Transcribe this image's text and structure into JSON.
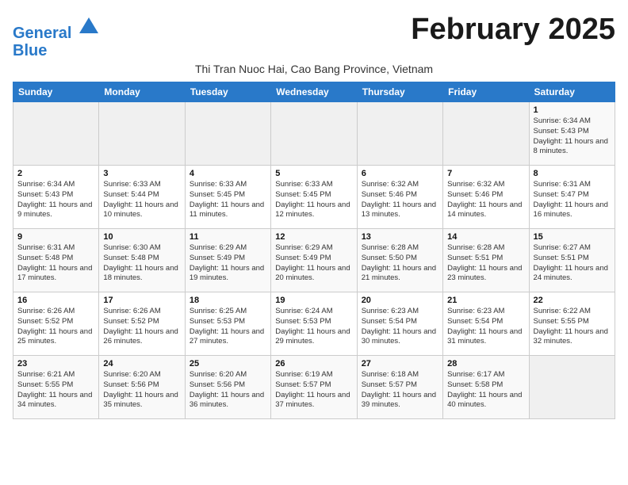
{
  "logo": {
    "line1": "General",
    "line2": "Blue"
  },
  "title": "February 2025",
  "location": "Thi Tran Nuoc Hai, Cao Bang Province, Vietnam",
  "weekdays": [
    "Sunday",
    "Monday",
    "Tuesday",
    "Wednesday",
    "Thursday",
    "Friday",
    "Saturday"
  ],
  "weeks": [
    [
      {
        "day": "",
        "info": ""
      },
      {
        "day": "",
        "info": ""
      },
      {
        "day": "",
        "info": ""
      },
      {
        "day": "",
        "info": ""
      },
      {
        "day": "",
        "info": ""
      },
      {
        "day": "",
        "info": ""
      },
      {
        "day": "1",
        "info": "Sunrise: 6:34 AM\nSunset: 5:43 PM\nDaylight: 11 hours and 8 minutes."
      }
    ],
    [
      {
        "day": "2",
        "info": "Sunrise: 6:34 AM\nSunset: 5:43 PM\nDaylight: 11 hours and 9 minutes."
      },
      {
        "day": "3",
        "info": "Sunrise: 6:33 AM\nSunset: 5:44 PM\nDaylight: 11 hours and 10 minutes."
      },
      {
        "day": "4",
        "info": "Sunrise: 6:33 AM\nSunset: 5:45 PM\nDaylight: 11 hours and 11 minutes."
      },
      {
        "day": "5",
        "info": "Sunrise: 6:33 AM\nSunset: 5:45 PM\nDaylight: 11 hours and 12 minutes."
      },
      {
        "day": "6",
        "info": "Sunrise: 6:32 AM\nSunset: 5:46 PM\nDaylight: 11 hours and 13 minutes."
      },
      {
        "day": "7",
        "info": "Sunrise: 6:32 AM\nSunset: 5:46 PM\nDaylight: 11 hours and 14 minutes."
      },
      {
        "day": "8",
        "info": "Sunrise: 6:31 AM\nSunset: 5:47 PM\nDaylight: 11 hours and 16 minutes."
      }
    ],
    [
      {
        "day": "9",
        "info": "Sunrise: 6:31 AM\nSunset: 5:48 PM\nDaylight: 11 hours and 17 minutes."
      },
      {
        "day": "10",
        "info": "Sunrise: 6:30 AM\nSunset: 5:48 PM\nDaylight: 11 hours and 18 minutes."
      },
      {
        "day": "11",
        "info": "Sunrise: 6:29 AM\nSunset: 5:49 PM\nDaylight: 11 hours and 19 minutes."
      },
      {
        "day": "12",
        "info": "Sunrise: 6:29 AM\nSunset: 5:49 PM\nDaylight: 11 hours and 20 minutes."
      },
      {
        "day": "13",
        "info": "Sunrise: 6:28 AM\nSunset: 5:50 PM\nDaylight: 11 hours and 21 minutes."
      },
      {
        "day": "14",
        "info": "Sunrise: 6:28 AM\nSunset: 5:51 PM\nDaylight: 11 hours and 23 minutes."
      },
      {
        "day": "15",
        "info": "Sunrise: 6:27 AM\nSunset: 5:51 PM\nDaylight: 11 hours and 24 minutes."
      }
    ],
    [
      {
        "day": "16",
        "info": "Sunrise: 6:26 AM\nSunset: 5:52 PM\nDaylight: 11 hours and 25 minutes."
      },
      {
        "day": "17",
        "info": "Sunrise: 6:26 AM\nSunset: 5:52 PM\nDaylight: 11 hours and 26 minutes."
      },
      {
        "day": "18",
        "info": "Sunrise: 6:25 AM\nSunset: 5:53 PM\nDaylight: 11 hours and 27 minutes."
      },
      {
        "day": "19",
        "info": "Sunrise: 6:24 AM\nSunset: 5:53 PM\nDaylight: 11 hours and 29 minutes."
      },
      {
        "day": "20",
        "info": "Sunrise: 6:23 AM\nSunset: 5:54 PM\nDaylight: 11 hours and 30 minutes."
      },
      {
        "day": "21",
        "info": "Sunrise: 6:23 AM\nSunset: 5:54 PM\nDaylight: 11 hours and 31 minutes."
      },
      {
        "day": "22",
        "info": "Sunrise: 6:22 AM\nSunset: 5:55 PM\nDaylight: 11 hours and 32 minutes."
      }
    ],
    [
      {
        "day": "23",
        "info": "Sunrise: 6:21 AM\nSunset: 5:55 PM\nDaylight: 11 hours and 34 minutes."
      },
      {
        "day": "24",
        "info": "Sunrise: 6:20 AM\nSunset: 5:56 PM\nDaylight: 11 hours and 35 minutes."
      },
      {
        "day": "25",
        "info": "Sunrise: 6:20 AM\nSunset: 5:56 PM\nDaylight: 11 hours and 36 minutes."
      },
      {
        "day": "26",
        "info": "Sunrise: 6:19 AM\nSunset: 5:57 PM\nDaylight: 11 hours and 37 minutes."
      },
      {
        "day": "27",
        "info": "Sunrise: 6:18 AM\nSunset: 5:57 PM\nDaylight: 11 hours and 39 minutes."
      },
      {
        "day": "28",
        "info": "Sunrise: 6:17 AM\nSunset: 5:58 PM\nDaylight: 11 hours and 40 minutes."
      },
      {
        "day": "",
        "info": ""
      }
    ]
  ]
}
